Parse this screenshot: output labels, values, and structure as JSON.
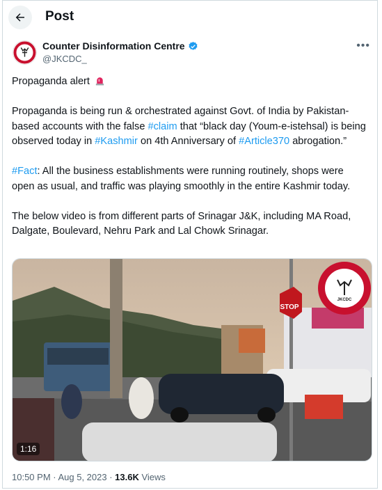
{
  "header": {
    "title": "Post"
  },
  "author": {
    "name": "Counter Disinformation Centre",
    "handle": "@JKCDC_"
  },
  "post": {
    "alert": "Propaganda alert",
    "p1": {
      "a": "Propaganda is being run & orchestrated against Govt. of India by Pakistan-based accounts with the false ",
      "claim": "#claim",
      "b": " that “black day (Youm-e-istehsal) is being observed today in ",
      "kashmir": "#Kashmir",
      "c": " on 4th Anniversary of ",
      "article": "#Article370",
      "d": " abrogation.”"
    },
    "p2": {
      "fact": "#Fact",
      "rest": ": All the business establishments were running routinely, shops were open as usual, and traffic was playing smoothly in the entire Kashmir today."
    },
    "p3": "The below video is from different parts of Srinagar J&K, including MA Road, Dalgate, Boulevard, Nehru Park and Lal Chowk Srinagar."
  },
  "media": {
    "duration": "1:16",
    "stop_sign": "STOP",
    "watermark": "JKCDC"
  },
  "meta": {
    "timestamp": "10:50 PM · Aug 5, 2023 · ",
    "views_count": "13.6K",
    "views_label": " Views"
  },
  "colors": {
    "link": "#1d9bf0",
    "verified": "#1d9bf0",
    "muted": "#536471"
  },
  "icons": {
    "back": "arrow-left-icon",
    "verified": "verified-badge-icon",
    "more": "more-icon",
    "alert": "rotating-light-icon"
  }
}
